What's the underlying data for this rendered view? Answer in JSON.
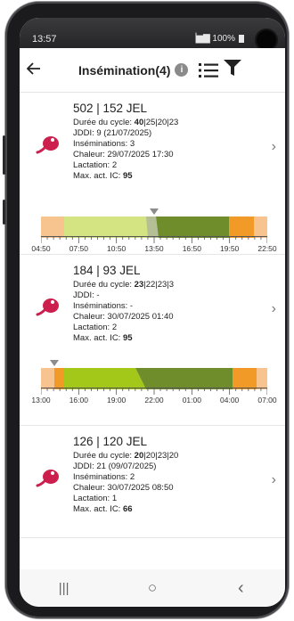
{
  "status": {
    "time": "13:57",
    "signal": "▕▆▇ 100%"
  },
  "header": {
    "title": "Insémination(4)",
    "info_glyph": "i"
  },
  "icons": {
    "back": "arrow-left-icon",
    "info": "info-icon",
    "list": "list-icon",
    "filter": "filter-icon",
    "cow": "cow-head-icon",
    "chevron": "chevron-right-icon"
  },
  "colors": {
    "peach": "#f7c38e",
    "light_green": "#d4e482",
    "olive": "#6f8e2b",
    "orange": "#f29a27",
    "lime": "#a4c819",
    "cow_red": "#cc1f4d"
  },
  "items": [
    {
      "name": "502 | 152 JEL",
      "cycle_label": "Durée du cycle: ",
      "cycle_bold": "40",
      "cycle_rest": "|25|20|23",
      "jddi": "JDDI: 9 (21/07/2025)",
      "inseminations": "Inséminations: 3",
      "chaleur": "Chaleur: 29/07/2025 17:30",
      "lactation": "Lactation: 2",
      "maxact_label": "Max. act. IC: ",
      "maxact_value": "95",
      "timeline": {
        "ticks": [
          "04:50",
          "07:50",
          "10:50",
          "13:50",
          "16:50",
          "19:50",
          "22:50"
        ],
        "marker_fraction": 0.5
      }
    },
    {
      "name": "184 | 93 JEL",
      "cycle_label": "Durée du cycle: ",
      "cycle_bold": "23",
      "cycle_rest": "|22|23|3",
      "jddi": "JDDI: -",
      "inseminations": "Inséminations: -",
      "chaleur": "Chaleur: 30/07/2025 01:40",
      "lactation": "Lactation: 2",
      "maxact_label": "Max. act. IC: ",
      "maxact_value": "95",
      "timeline": {
        "ticks": [
          "13:00",
          "16:00",
          "19:00",
          "22:00",
          "01:00",
          "04:00",
          "07:00"
        ],
        "marker_fraction": 0.06
      }
    },
    {
      "name": "126 | 120 JEL",
      "cycle_label": "Durée du cycle: ",
      "cycle_bold": "20",
      "cycle_rest": "|20|23|20",
      "jddi": "JDDI: 21 (09/07/2025)",
      "inseminations": "Inséminations: 2",
      "chaleur": "Chaleur: 30/07/2025 08:50",
      "lactation": "Lactation: 1",
      "maxact_label": "Max. act. IC: ",
      "maxact_value": "66"
    }
  ],
  "navbar": {
    "recents": "|||",
    "home": "○",
    "back": "‹"
  }
}
